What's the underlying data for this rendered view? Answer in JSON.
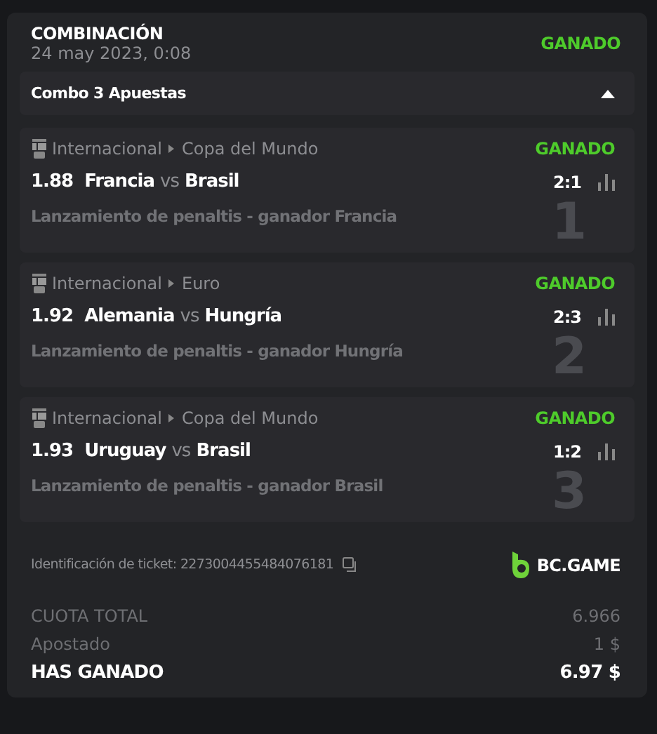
{
  "header": {
    "title": "COMBINACIÓN",
    "date": "24 may 2023, 0:08",
    "status": "GANADO"
  },
  "combo": {
    "label": "Combo 3 Apuestas",
    "expanded": true
  },
  "bets": [
    {
      "number": "1",
      "category": "Internacional",
      "league": "Copa del Mundo",
      "status": "GANADO",
      "odds": "1.88",
      "home": "Francia",
      "vs": "vs",
      "away": "Brasil",
      "score": "2:1",
      "market": "Lanzamiento de penaltis - ganador Francia"
    },
    {
      "number": "2",
      "category": "Internacional",
      "league": "Euro",
      "status": "GANADO",
      "odds": "1.92",
      "home": "Alemania",
      "vs": "vs",
      "away": "Hungría",
      "score": "2:3",
      "market": "Lanzamiento de penaltis - ganador Hungría"
    },
    {
      "number": "3",
      "category": "Internacional",
      "league": "Copa del Mundo",
      "status": "GANADO",
      "odds": "1.93",
      "home": "Uruguay",
      "vs": "vs",
      "away": "Brasil",
      "score": "1:2",
      "market": "Lanzamiento de penaltis - ganador Brasil"
    }
  ],
  "ticket": {
    "text": "Identificación de ticket: 2273004455484076181",
    "brand": "BC.GAME"
  },
  "totals": [
    {
      "kind": "normal",
      "label": "CUOTA TOTAL",
      "value": "6.966"
    },
    {
      "kind": "normal",
      "label": "Apostado",
      "value": "1 $"
    },
    {
      "kind": "total",
      "label": "HAS GANADO",
      "value": "6.97 $"
    }
  ]
}
